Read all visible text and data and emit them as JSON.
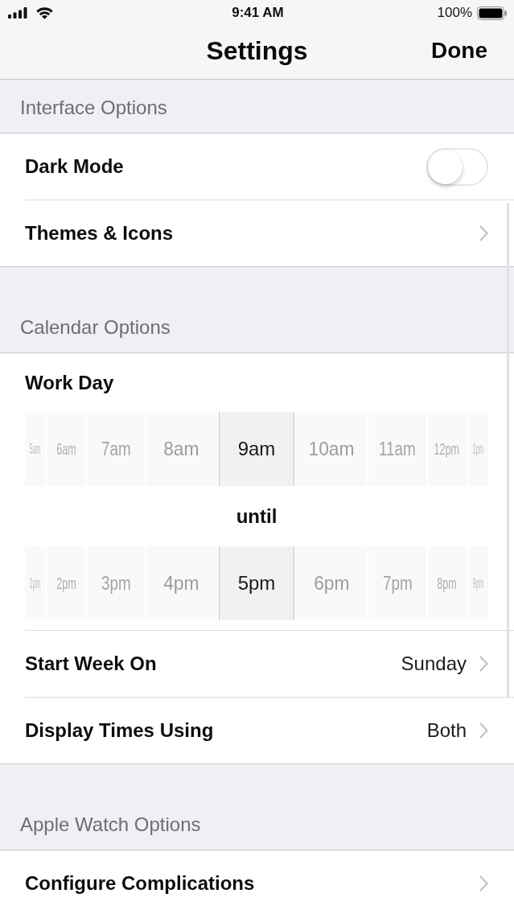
{
  "status_bar": {
    "time": "9:41 AM",
    "battery": "100%"
  },
  "nav_bar": {
    "title": "Settings",
    "done_button": "Done"
  },
  "sections": [
    {
      "header": "Interface Options",
      "rows": [
        {
          "kind": "toggle",
          "label": "Dark Mode",
          "on": false
        },
        {
          "kind": "link",
          "label": "Themes & Icons"
        }
      ]
    },
    {
      "header": "Calendar Options",
      "rows": [
        {
          "kind": "label",
          "label": "Work Day"
        },
        {
          "kind": "picker",
          "options": [
            {
              "label": "5am",
              "selected": false
            },
            {
              "label": "6am",
              "selected": false
            },
            {
              "label": "7am",
              "selected": false
            },
            {
              "label": "8am",
              "selected": false
            },
            {
              "label": "9am",
              "selected": true
            },
            {
              "label": "10am",
              "selected": false
            },
            {
              "label": "11am",
              "selected": false
            },
            {
              "label": "12pm",
              "selected": false
            },
            {
              "label": "1pm",
              "selected": false
            }
          ]
        },
        {
          "kind": "caption",
          "label": "until"
        },
        {
          "kind": "picker",
          "options": [
            {
              "label": "1pm",
              "selected": false
            },
            {
              "label": "2pm",
              "selected": false
            },
            {
              "label": "3pm",
              "selected": false
            },
            {
              "label": "4pm",
              "selected": false
            },
            {
              "label": "5pm",
              "selected": true
            },
            {
              "label": "6pm",
              "selected": false
            },
            {
              "label": "7pm",
              "selected": false
            },
            {
              "label": "8pm",
              "selected": false
            },
            {
              "label": "9pm",
              "selected": false
            }
          ]
        },
        {
          "kind": "value",
          "label": "Start Week On",
          "value": "Sunday"
        },
        {
          "kind": "value",
          "label": "Display Times Using",
          "value": "Both"
        }
      ]
    },
    {
      "header": "Apple Watch Options",
      "rows": [
        {
          "kind": "link",
          "label": "Configure Complications"
        }
      ]
    }
  ]
}
